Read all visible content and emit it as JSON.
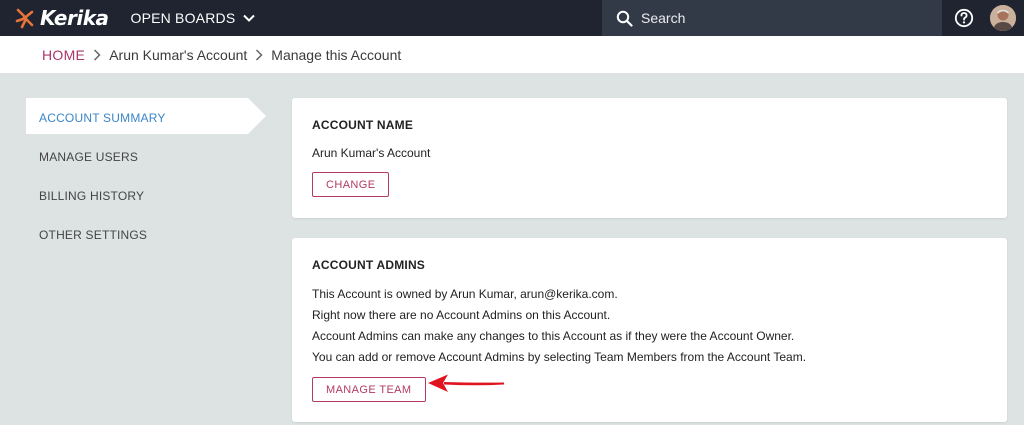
{
  "brand": {
    "name": "Kerika"
  },
  "topbar": {
    "boards_label": "OPEN BOARDS",
    "search_placeholder": "Search"
  },
  "breadcrumb": {
    "home": "HOME",
    "account": "Arun Kumar's Account",
    "current": "Manage this Account"
  },
  "sidebar": {
    "items": [
      {
        "label": "ACCOUNT SUMMARY",
        "active": true
      },
      {
        "label": "MANAGE USERS"
      },
      {
        "label": "BILLING HISTORY"
      },
      {
        "label": "OTHER SETTINGS"
      }
    ]
  },
  "account_name": {
    "title": "ACCOUNT NAME",
    "value": "Arun Kumar's Account",
    "button": "CHANGE"
  },
  "account_admins": {
    "title": "ACCOUNT ADMINS",
    "lines": [
      "This Account is owned by Arun Kumar, arun@kerika.com.",
      "Right now there are no Account Admins on this Account.",
      "Account Admins can make any changes to this Account as if they were the Account Owner.",
      "You can add or remove Account Admins by selecting Team Members from the Account Team."
    ],
    "button": "MANAGE TEAM"
  },
  "colors": {
    "topbar": "#1f2430",
    "accent": "#b23a66",
    "active_nav": "#3a86c8",
    "annotation_arrow": "#e0141e"
  }
}
